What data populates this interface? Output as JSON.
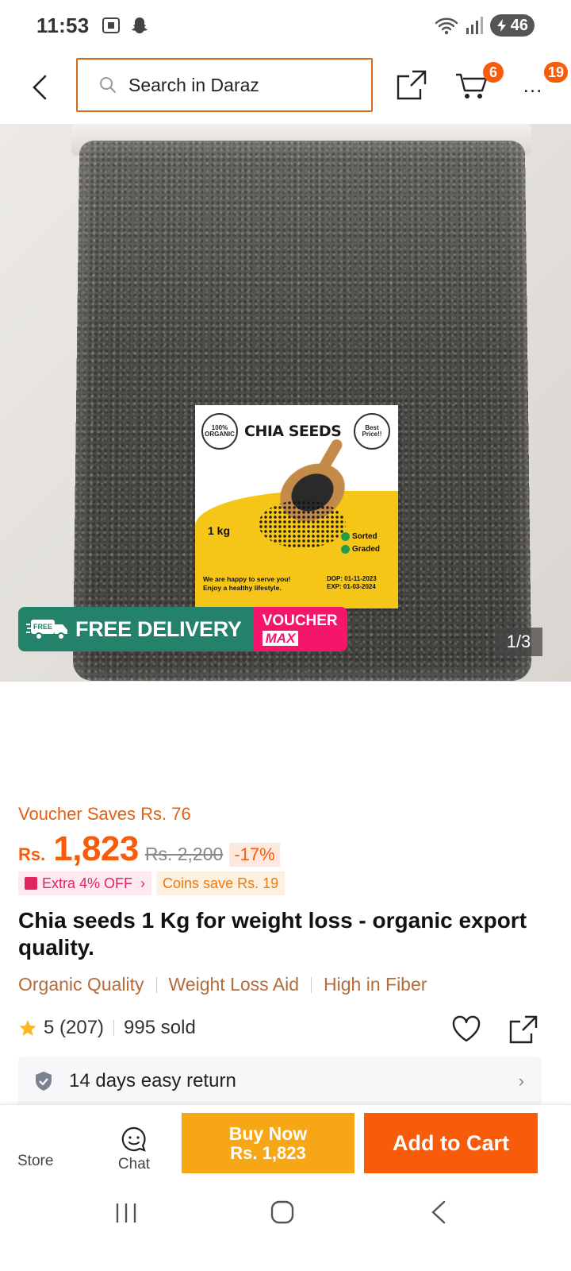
{
  "status_bar": {
    "time": "11:53",
    "battery": "46"
  },
  "header": {
    "search_placeholder": "Search in Daraz",
    "cart_badge": "6",
    "more_badge": "19",
    "more_label": "…"
  },
  "product_image": {
    "label_title": "CHIA SEEDS",
    "label_organic": "100% ORGANIC",
    "label_best": "Best Price!!",
    "label_weight": "1 kg",
    "label_sorted": "Sorted",
    "label_graded": "Graded",
    "label_footer_left_1": "We are happy to serve you!",
    "label_footer_left_2": "Enjoy a healthy lifestyle.",
    "label_dop": "DOP: 01-11-2023",
    "label_exp": "EXP: 01-03-2024",
    "promo_free_delivery": "FREE DELIVERY",
    "promo_voucher_1": "VOUCHER",
    "promo_voucher_2": "MAX",
    "counter": "1/3"
  },
  "product": {
    "voucher_saves": "Voucher Saves Rs. 76",
    "currency": "Rs.",
    "price": "1,823",
    "old_price": "Rs. 2,200",
    "discount": "-17%",
    "extra_off": "Extra 4% OFF",
    "coins_save": "Coins save Rs. 19",
    "title": "Chia seeds 1 Kg for weight loss - organic export quality.",
    "features": [
      "Organic Quality",
      "Weight Loss Aid",
      "High in Fiber"
    ],
    "rating": "5 (207)",
    "sold": "995 sold",
    "return_policy": "14 days easy return"
  },
  "bottom_bar": {
    "store_label": "Store",
    "chat_label": "Chat",
    "buy_now_label": "Buy Now",
    "buy_now_price": "Rs. 1,823",
    "add_to_cart_label": "Add to Cart"
  },
  "colors": {
    "accent": "#f85c0a",
    "buy_now": "#f7a715",
    "search_border": "#d86a1e",
    "free_delivery": "#24826a",
    "voucher_max": "#f5156a"
  }
}
